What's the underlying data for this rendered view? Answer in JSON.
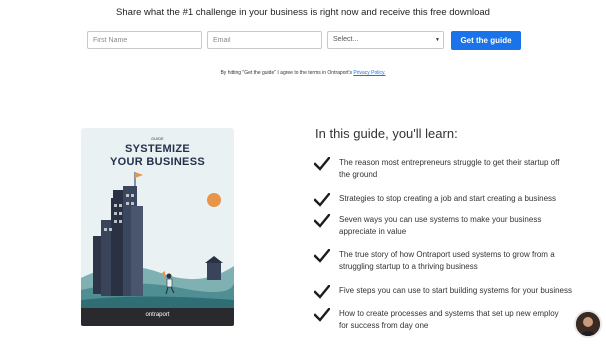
{
  "header": {
    "headline": "Share what the #1 challenge in your business is right now and receive this free download"
  },
  "form": {
    "first_name_placeholder": "First Name",
    "email_placeholder": "Email",
    "select_value": "Select...",
    "submit_label": "Get the guide",
    "accent_color": "#1a73e8"
  },
  "terms": {
    "text": "By hitting \"Get the guide\" I agree to the terms in Ontraport's",
    "link_label": "Privacy Policy."
  },
  "book": {
    "label": "GUIDE",
    "title_line1": "SYSTEMIZE",
    "title_line2": "YOUR BUSINESS",
    "brand": "ontraport"
  },
  "guide": {
    "title": "In this guide, you'll learn:",
    "items": [
      {
        "line1": "The reason most entrepreneurs struggle to get their startup off",
        "line2": "the ground"
      },
      {
        "line1": "Strategies to stop creating a job and start creating a business",
        "line2": ""
      },
      {
        "line1": "Seven ways you can use systems to make your business",
        "line2": "appreciate in value"
      },
      {
        "line1": "The true story of how Ontraport used systems to grow from a",
        "line2": "struggling startup to a thriving business"
      },
      {
        "line1": "Five steps you can use to start building systems for your business",
        "line2": ""
      },
      {
        "line1": "How to create processes and systems that set up new employ",
        "line2": "for success from day one"
      }
    ]
  }
}
